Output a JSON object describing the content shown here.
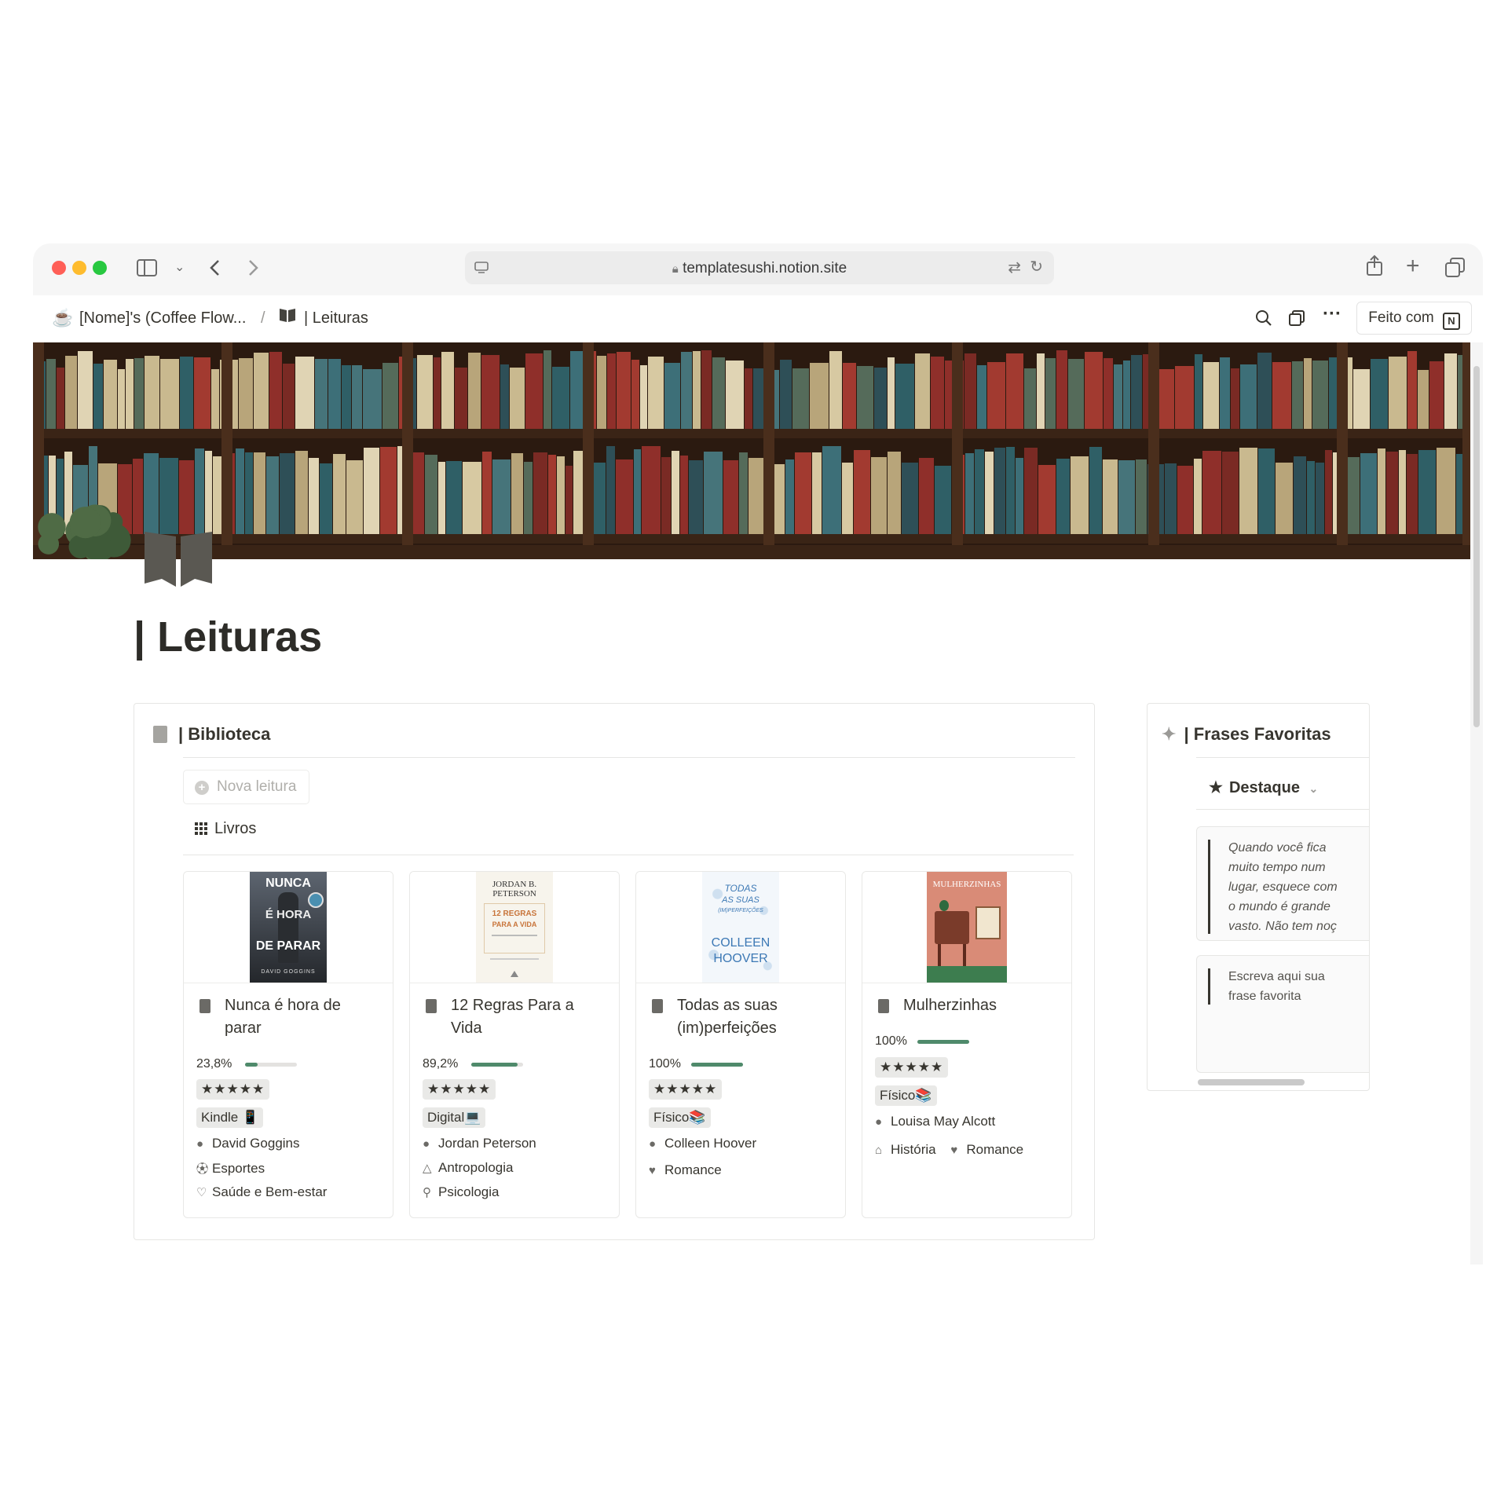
{
  "browser": {
    "url": "templatesushi.notion.site"
  },
  "breadcrumb": {
    "workspace": "[Nome]'s (Coffee Flow...",
    "separator": "/",
    "page": "| Leituras"
  },
  "topbar": {
    "feito_com": "Feito com"
  },
  "page": {
    "title": "| Leituras"
  },
  "biblioteca": {
    "title": "| Biblioteca",
    "new_button": "Nova leitura",
    "view_name": "Livros",
    "books": [
      {
        "title": "Nunca é hora de parar",
        "progress_label": "23,8%",
        "progress": 0.238,
        "rating": "★★★★★",
        "format": "Kindle 📱",
        "author": "David Goggins",
        "categories": [
          "Esportes",
          "Saúde e Bem-estar"
        ],
        "cover": {
          "line1": "NUNCA",
          "line2": "É HORA",
          "line3": "DE PARAR",
          "author": "DAVID GOGGINS"
        }
      },
      {
        "title": "12 Regras Para a Vida",
        "progress_label": "89,2%",
        "progress": 0.892,
        "rating": "★★★★★",
        "format": "Digital💻",
        "author": "Jordan Peterson",
        "categories": [
          "Antropologia",
          "Psicologia"
        ],
        "cover": {
          "line1": "JORDAN B.",
          "line2": "PETERSON",
          "line3": "12 REGRAS",
          "line4": "PARA A VIDA"
        }
      },
      {
        "title": "Todas as suas (im)perfeições",
        "progress_label": "100%",
        "progress": 1.0,
        "rating": "★★★★★",
        "format": "Físico📚",
        "author": "Colleen Hoover",
        "categories": [
          "Romance"
        ],
        "cover": {
          "line1": "TODAS",
          "line2": "AS SUAS",
          "line3": "(IM)PERFEIÇÕES",
          "author1": "COLLEEN",
          "author2": "HOOVER"
        }
      },
      {
        "title": "Mulherzinhas",
        "progress_label": "100%",
        "progress": 1.0,
        "rating": "★★★★★",
        "format": "Físico📚",
        "author": "Louisa May Alcott",
        "categories": [
          "História",
          "Romance"
        ],
        "cover": {
          "line1": "MULHERZINHAS"
        }
      }
    ]
  },
  "frases": {
    "title": "| Frases Favoritas",
    "filter": "Destaque",
    "quotes": [
      [
        "Quando você fica",
        "muito tempo num",
        "lugar, esquece com",
        "o mundo é grande",
        "vasto. Não tem noç"
      ],
      [
        "Escreva aqui sua",
        "frase favorita"
      ]
    ]
  },
  "colors": {
    "accent_progress": "#4f8a6b",
    "text": "#37352f"
  }
}
